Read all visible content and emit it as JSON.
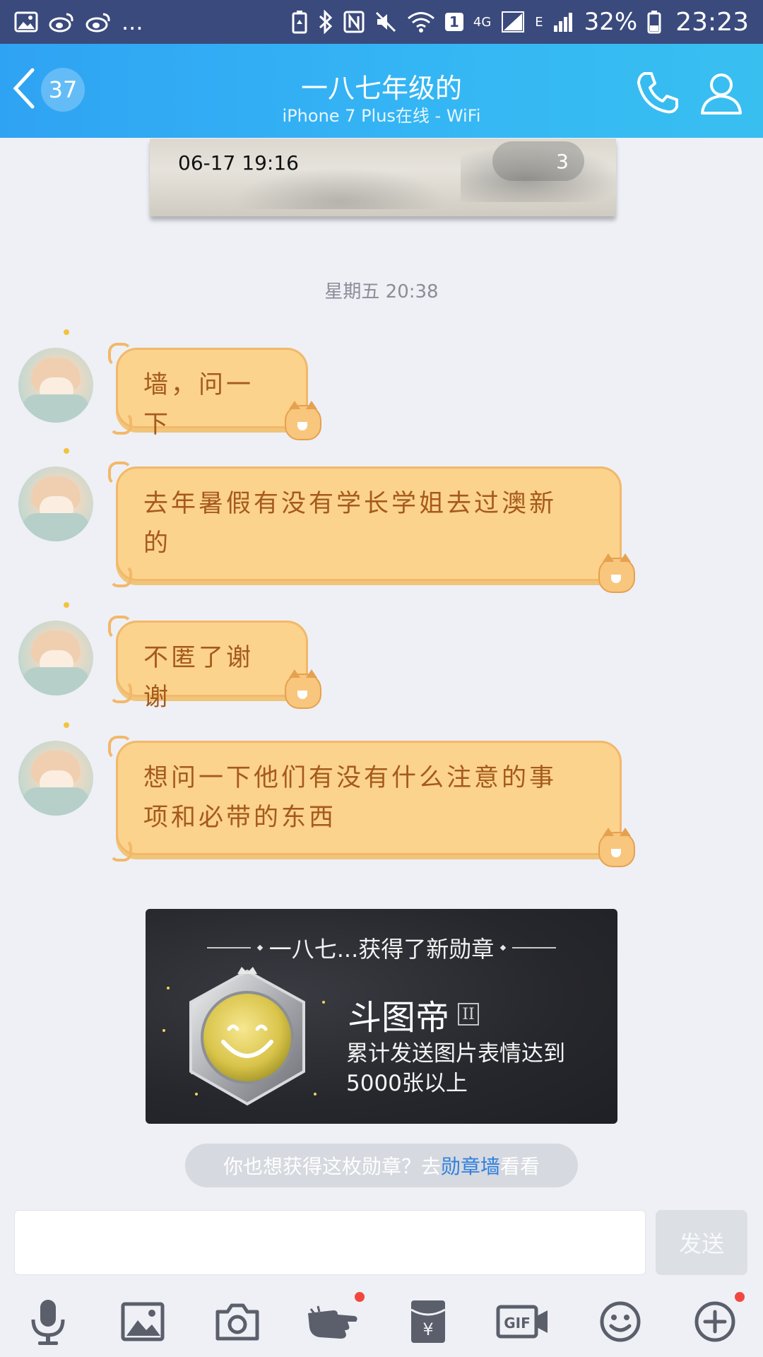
{
  "status_bar": {
    "battery_percent": "32%",
    "time": "23:23",
    "network_4g": "4G",
    "network_e": "E",
    "sim_badge": "1",
    "more": "..."
  },
  "header": {
    "unread_count": "37",
    "title": "一八七年级的",
    "subtitle": "iPhone 7 Plus在线 - WiFi"
  },
  "previous_card": {
    "date": "06-17 19:16",
    "count": "3"
  },
  "timestamp": "星期五 20:38",
  "messages": [
    {
      "line1": "墙，问一下",
      "line2": ""
    },
    {
      "line1": "去年暑假有没有学长学姐去过澳新",
      "line2": "的"
    },
    {
      "line1": "不匿了谢谢",
      "line2": ""
    },
    {
      "line1": "想问一下他们有没有什么注意的事",
      "line2": "项和必带的东西"
    }
  ],
  "medal": {
    "title": "一八七...获得了新勋章",
    "name": "斗图帝",
    "level": "II",
    "desc_line1": "累计发送图片表情达到",
    "desc_line2": "5000张以上",
    "tip_prefix": "你也想获得这枚勋章？去",
    "tip_link": "勋章墙",
    "tip_suffix": "看看"
  },
  "input": {
    "placeholder": "",
    "send_label": "发送"
  },
  "toolbar": {
    "gif_label": "GIF",
    "icons": [
      "microphone-icon",
      "image-icon",
      "camera-icon",
      "poke-icon",
      "red-envelope-icon",
      "gif-icon",
      "emoji-icon",
      "plus-icon"
    ]
  },
  "colors": {
    "header": "#2fa3f3",
    "bubble": "#fbd38c",
    "bubble_text": "#a65a1c",
    "link": "#2e7fe0",
    "notification_dot": "#f2473f"
  }
}
